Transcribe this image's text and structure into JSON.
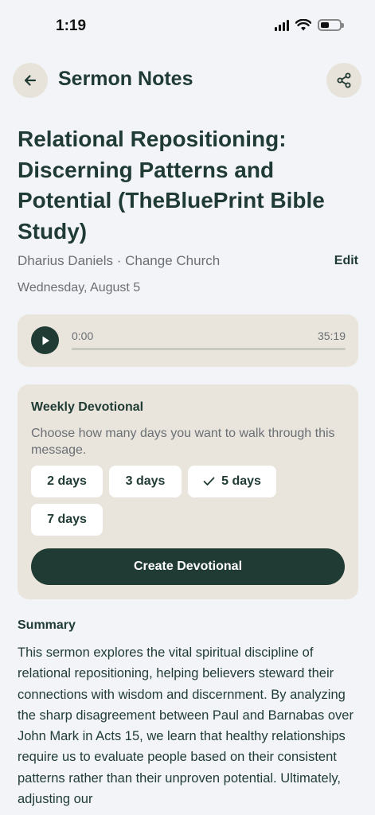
{
  "status_bar": {
    "time": "1:19",
    "signal_icon": "cellular-signal-icon",
    "wifi_icon": "wifi-icon",
    "battery_icon": "battery-icon",
    "battery_level": 0.45
  },
  "header": {
    "title": "Sermon Notes",
    "back_icon": "arrow-left-icon",
    "share_icon": "share-icon"
  },
  "sermon": {
    "title": "Relational Repositioning: Discerning Patterns and Potential (TheBluePrint Bible Study)",
    "speaker_church": "Dharius Daniels · Change Church",
    "edit_label": "Edit",
    "date": "Wednesday, August 5"
  },
  "player": {
    "current_time": "0:00",
    "total_time": "35:19",
    "progress": 0,
    "play_icon": "play-icon"
  },
  "devotional": {
    "title": "Weekly Devotional",
    "description": "Choose how many days you want to walk through this message.",
    "options": [
      {
        "label": "2 days",
        "selected": false
      },
      {
        "label": "3 days",
        "selected": false
      },
      {
        "label": "5 days",
        "selected": true
      },
      {
        "label": "7 days",
        "selected": false
      }
    ],
    "check_icon": "checkmark-icon",
    "create_label": "Create Devotional"
  },
  "summary": {
    "title": "Summary",
    "body": "This sermon explores the vital spiritual discipline of relational repositioning, helping believers steward their connections with wisdom and discernment. By analyzing the sharp disagreement between Paul and Barnabas over John Mark in Acts 15, we learn that healthy relationships require us to evaluate people based on their consistent patterns rather than their unproven potential. Ultimately, adjusting our"
  },
  "colors": {
    "background": "#f2f4f8",
    "primary": "#1f3b34",
    "card": "#e9e5dd",
    "muted_text": "#6b6f74",
    "chip": "#ffffff"
  }
}
